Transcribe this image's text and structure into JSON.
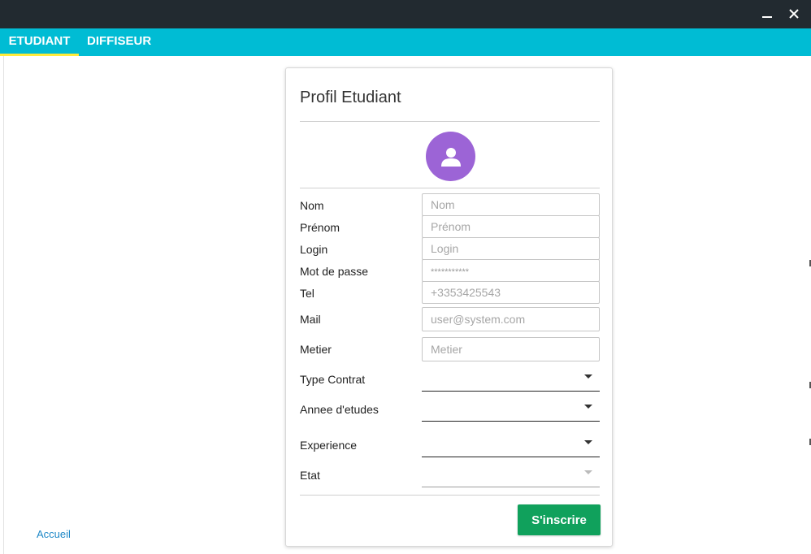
{
  "window": {
    "minimize_icon": "minimize-icon",
    "close_icon": "close-icon"
  },
  "tabs": [
    {
      "label": "ETUDIANT",
      "active": true
    },
    {
      "label": "DIFFISEUR",
      "active": false
    }
  ],
  "colors": {
    "titlebar": "#222a30",
    "tabbar": "#00bcd4",
    "tab_indicator": "#ffeb3b",
    "avatar": "#9c64d6",
    "submit": "#10a15c",
    "link": "#1e88c7"
  },
  "card": {
    "title": "Profil Etudiant",
    "avatar_icon": "user-icon",
    "fields": {
      "nom": {
        "label": "Nom",
        "placeholder": "Nom"
      },
      "prenom": {
        "label": "Prénom",
        "placeholder": "Prénom"
      },
      "login": {
        "label": "Login",
        "placeholder": "Login"
      },
      "password": {
        "label": "Mot de passe",
        "placeholder": "***********"
      },
      "tel": {
        "label": "Tel",
        "placeholder": "+3353425543"
      },
      "mail": {
        "label": "Mail",
        "placeholder": "user@system.com"
      },
      "metier": {
        "label": "Metier",
        "placeholder": "Metier"
      }
    },
    "selects": {
      "type_contrat": {
        "label": "Type Contrat",
        "value": ""
      },
      "annee_etudes": {
        "label": "Annee d'etudes",
        "value": ""
      },
      "experience": {
        "label": "Experience",
        "value": ""
      },
      "etat": {
        "label": "Etat",
        "value": "",
        "disabled": true
      }
    },
    "submit_label": "S'inscrire"
  },
  "footer": {
    "home_link": "Accueil"
  }
}
